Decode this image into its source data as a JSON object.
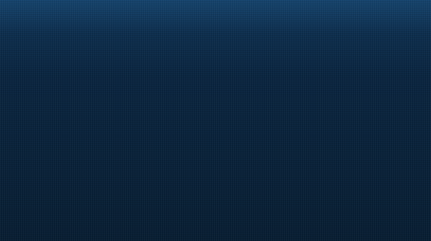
{
  "screen": {
    "background_colors": {
      "top": "#0f3558",
      "middle": "#0a2540",
      "bottom": "#081e33"
    }
  }
}
